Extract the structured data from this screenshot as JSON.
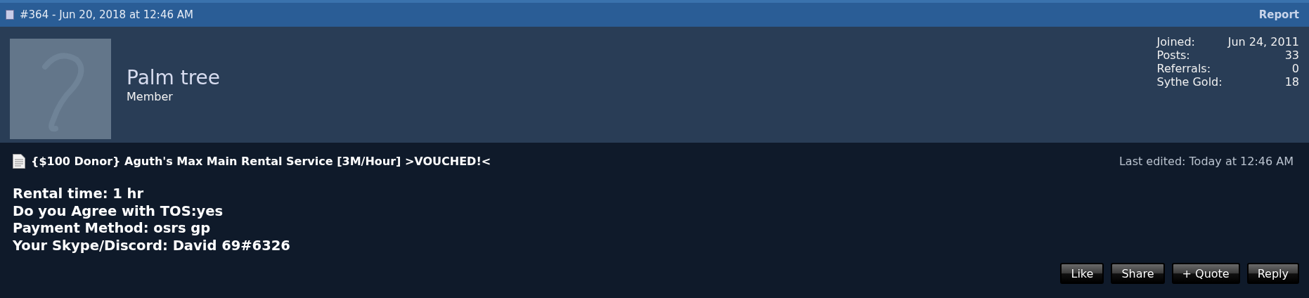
{
  "header": {
    "title": "#364 - Jun 20, 2018 at 12:46 AM",
    "report_link": "Report"
  },
  "user": {
    "name": "Palm tree",
    "rank": "Member",
    "stats": [
      {
        "label": "Joined:",
        "value": "Jun 24, 2011"
      },
      {
        "label": "Posts:",
        "value": "33"
      },
      {
        "label": "Referrals:",
        "value": "0"
      },
      {
        "label": "Sythe Gold:",
        "value": "18"
      }
    ]
  },
  "post": {
    "title": "{$100 Donor} Aguth's Max Main Rental Service [3M/Hour] >VOUCHED!<",
    "last_edited": "Last edited: Today at 12:46 AM",
    "lines": [
      "Rental time: 1 hr",
      "Do you Agree with TOS:yes",
      "Payment Method: osrs gp",
      "Your Skype/Discord: David 69#6326"
    ]
  },
  "buttons": [
    "Like",
    "Share",
    "+ Quote",
    "Reply"
  ]
}
